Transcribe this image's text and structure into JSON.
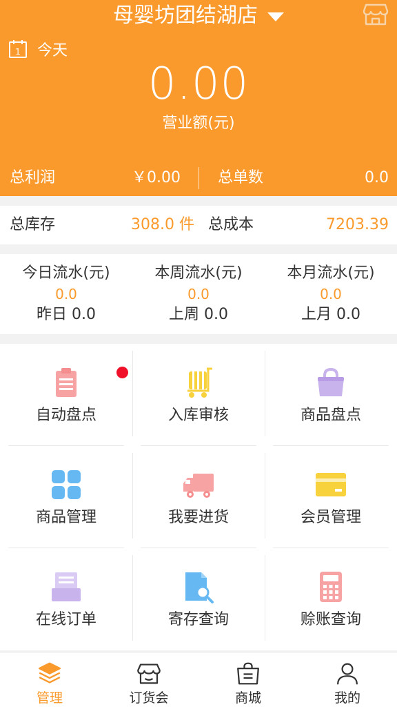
{
  "header": {
    "store_name": "母婴坊团结湖店",
    "date_label": "今天",
    "sales_amount": "0.00",
    "sales_label": "营业额(元)",
    "profit_label": "总利润",
    "profit_value": "￥0.00",
    "orders_label": "总单数",
    "orders_value": "0.0"
  },
  "inventory": {
    "stock_label": "总库存",
    "stock_value": "308.0 件",
    "cost_label": "总成本",
    "cost_value": "7203.39"
  },
  "flow": [
    {
      "label": "今日流水(元)",
      "value": "0.0",
      "prev": "昨日 0.0"
    },
    {
      "label": "本周流水(元)",
      "value": "0.0",
      "prev": "上周 0.0"
    },
    {
      "label": "本月流水(元)",
      "value": "0.0",
      "prev": "上月 0.0"
    }
  ],
  "menu": [
    {
      "label": "自动盘点",
      "icon": "clipboard-icon",
      "color": "#f7a3a3"
    },
    {
      "label": "入库审核",
      "icon": "cart-icon",
      "color": "#f7d23c"
    },
    {
      "label": "商品盘点",
      "icon": "basket-icon",
      "color": "#c9b3ec"
    },
    {
      "label": "商品管理",
      "icon": "grid-icon",
      "color": "#66b8f2"
    },
    {
      "label": "我要进货",
      "icon": "truck-icon",
      "color": "#f7a3a3"
    },
    {
      "label": "会员管理",
      "icon": "card-icon",
      "color": "#f7d23c"
    },
    {
      "label": "在线订单",
      "icon": "document-icon",
      "color": "#c9b3ec"
    },
    {
      "label": "寄存查询",
      "icon": "search-file-icon",
      "color": "#66b8f2"
    },
    {
      "label": "赊账查询",
      "icon": "calculator-icon",
      "color": "#f7a3a3"
    }
  ],
  "nav": [
    {
      "label": "管理",
      "icon": "layers-icon",
      "active": true
    },
    {
      "label": "订货会",
      "icon": "store-icon",
      "active": false
    },
    {
      "label": "商城",
      "icon": "shopping-bag-icon",
      "active": false
    },
    {
      "label": "我的",
      "icon": "user-icon",
      "active": false
    }
  ],
  "colors": {
    "accent": "#fa9a2c",
    "badge": "#f0102a"
  }
}
